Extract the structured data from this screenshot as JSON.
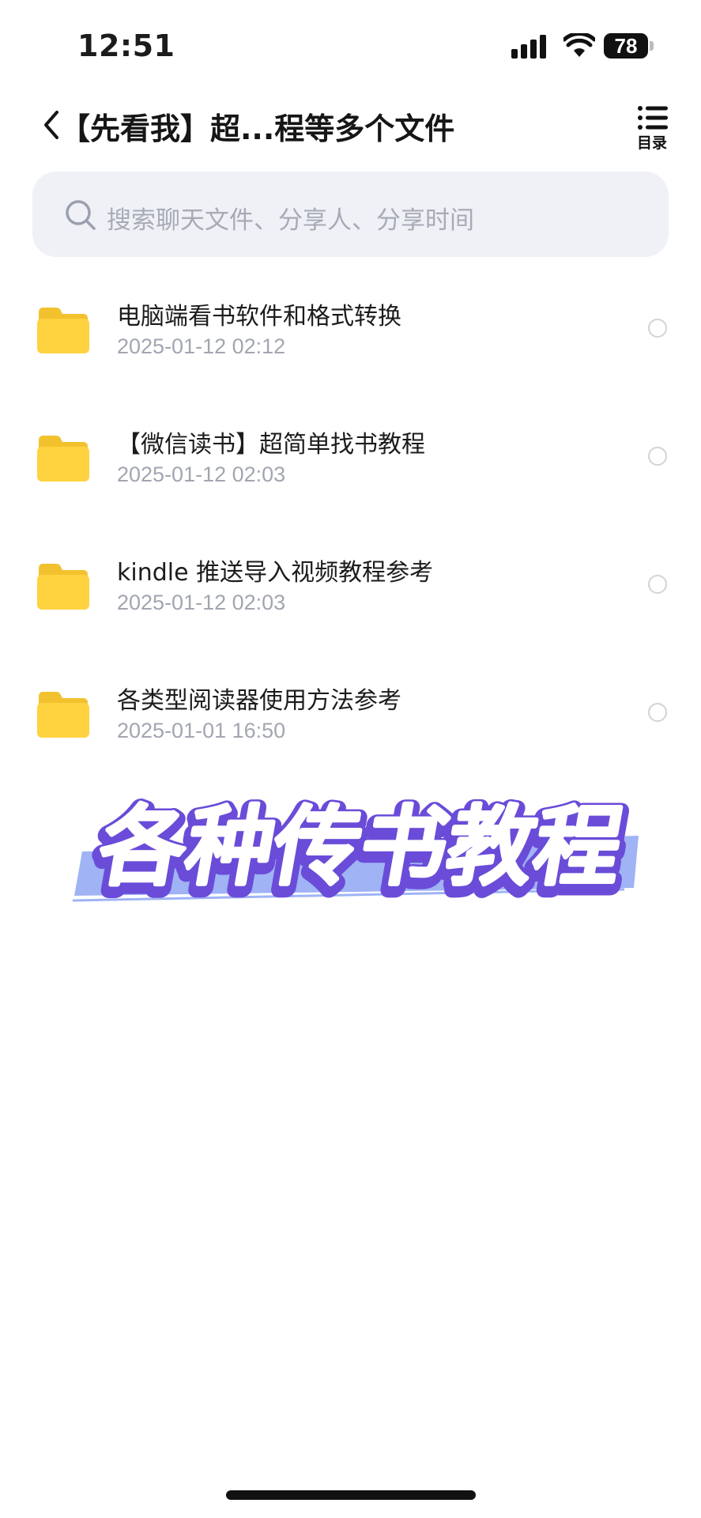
{
  "status_bar": {
    "time": "12:51",
    "battery": "78"
  },
  "nav": {
    "title": "【先看我】超...程等多个文件",
    "menu_label": "目录"
  },
  "search": {
    "placeholder": "搜索聊天文件、分享人、分享时间"
  },
  "files": [
    {
      "name": "电脑端看书软件和格式转换",
      "date": "2025-01-12 02:12",
      "icon": "folder-icon"
    },
    {
      "name": "【微信读书】超简单找书教程",
      "date": "2025-01-12 02:03",
      "icon": "folder-icon"
    },
    {
      "name": "kindle 推送导入视频教程参考",
      "date": "2025-01-12 02:03",
      "icon": "folder-icon"
    },
    {
      "name": "各类型阅读器使用方法参考",
      "date": "2025-01-01 16:50",
      "icon": "folder-icon"
    }
  ],
  "overlay": {
    "caption": "各种传书教程"
  },
  "colors": {
    "folder": "#ffd23f",
    "caption_fill": "#ffffff",
    "caption_outline": "#6a4cd8",
    "caption_stripe": "#9fb3f5"
  }
}
